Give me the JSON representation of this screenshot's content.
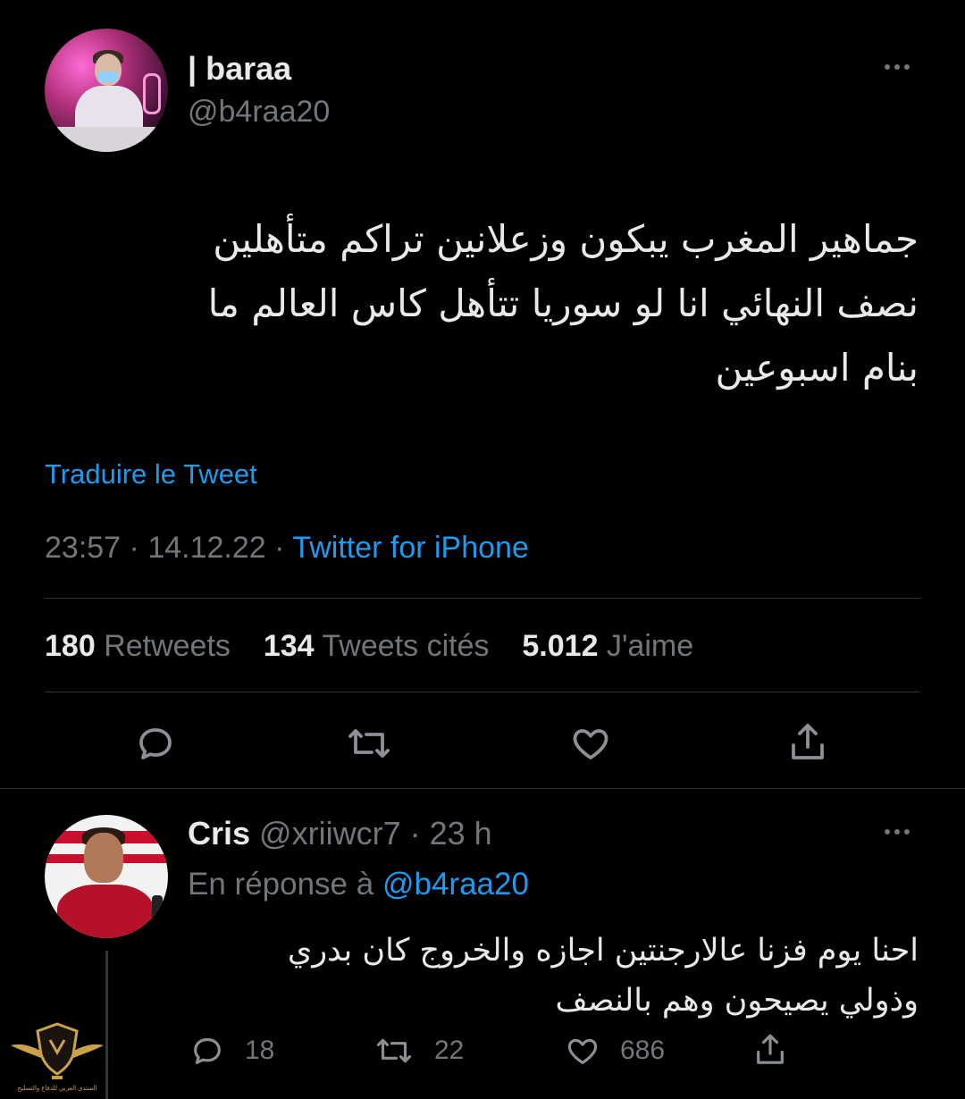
{
  "main_tweet": {
    "display_name": "| baraa",
    "handle": "@b4raa20",
    "text_lines": [
      "جماهير المغرب يبكون وزعلانين تراكم متأهلين",
      "نصف النهائي انا لو سوريا تتأهل كاس العالم ما",
      "بنام اسبوعين"
    ],
    "translate_label": "Traduire le Tweet",
    "time": "23:57",
    "separator": "·",
    "date": "14.12.22",
    "source": "Twitter for iPhone",
    "stats": {
      "retweets_count": "180",
      "retweets_label": "Retweets",
      "quotes_count": "134",
      "quotes_label": "Tweets cités",
      "likes_count": "5.012",
      "likes_label": "J'aime"
    },
    "actions": [
      "reply-icon",
      "retweet-icon",
      "like-icon",
      "share-icon"
    ]
  },
  "reply_tweet": {
    "display_name": "Cris",
    "handle": "@xriiwcr7",
    "separator": "·",
    "time_ago": "23 h",
    "reply_prefix": "En réponse à",
    "reply_mention": "@b4raa20",
    "text_lines": [
      "احنا يوم فزنا عالارجنتين اجازه والخروج كان بدري",
      "وذولي يصيحون وهم بالنصف"
    ],
    "actions": {
      "replies": "18",
      "retweets": "22",
      "likes": "686"
    }
  },
  "watermark": {
    "text": "المنتدى العربي للدفاع والتسليح"
  },
  "colors": {
    "background": "#000000",
    "text": "#e7e9ea",
    "muted": "#71767b",
    "link": "#1d9bf0",
    "divider": "#2f3336"
  }
}
